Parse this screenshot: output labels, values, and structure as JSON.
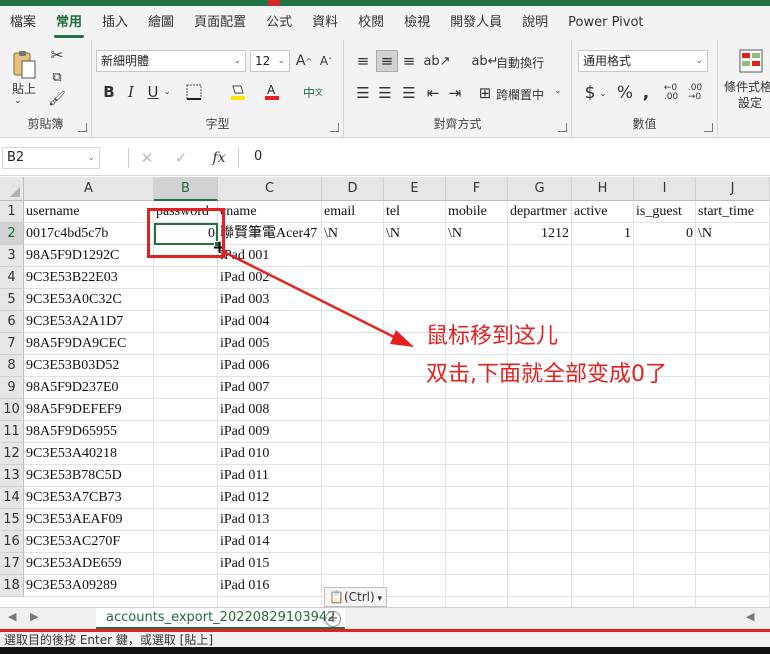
{
  "ribbon_tabs": [
    "檔案",
    "常用",
    "插入",
    "繪圖",
    "頁面配置",
    "公式",
    "資料",
    "校閱",
    "檢視",
    "開發人員",
    "說明",
    "Power Pivot"
  ],
  "active_tab": "常用",
  "clipboard": {
    "paste_label": "貼上",
    "group_label": "剪貼簿"
  },
  "font": {
    "name": "新細明體",
    "size": "12",
    "group_label": "字型",
    "bold": "B",
    "italic": "I",
    "underline": "U"
  },
  "alignment": {
    "wrap_text": "自動換行",
    "merge_center": "跨欄置中",
    "group_label": "對齊方式"
  },
  "number": {
    "format": "通用格式",
    "currency": "$",
    "percent": "%",
    "comma": ",",
    "group_label": "數值"
  },
  "styles": {
    "conditional_format": "條件式格",
    "format_label": "設定"
  },
  "formula_bar": {
    "name_box": "B2",
    "fx": "fx",
    "value": "0"
  },
  "columns": [
    "A",
    "B",
    "C",
    "D",
    "E",
    "F",
    "G",
    "H",
    "I",
    "J"
  ],
  "rows": [
    {
      "n": "1",
      "a": "username",
      "b": "password",
      "c": "cname",
      "d": "email",
      "e": "tel",
      "f": "mobile",
      "g": "departmer",
      "h": "active",
      "i": "is_guest",
      "j": "start_time"
    },
    {
      "n": "2",
      "a": "0017c4bd5c7b",
      "b": "0",
      "c": "聯賢筆電Acer47",
      "d": "\\N",
      "e": "\\N",
      "f": "\\N",
      "g": "1212",
      "h": "1",
      "i": "0",
      "j": "\\N"
    },
    {
      "n": "3",
      "a": "98A5F9D1292C",
      "c": "iPad 001"
    },
    {
      "n": "4",
      "a": "9C3E53B22E03",
      "c": "iPad 002"
    },
    {
      "n": "5",
      "a": "9C3E53A0C32C",
      "c": "iPad 003"
    },
    {
      "n": "6",
      "a": "9C3E53A2A1D7",
      "c": "iPad 004"
    },
    {
      "n": "7",
      "a": "98A5F9DA9CEC",
      "c": "iPad 005"
    },
    {
      "n": "8",
      "a": "9C3E53B03D52",
      "c": "iPad 006"
    },
    {
      "n": "9",
      "a": "98A5F9D237E0",
      "c": "iPad 007"
    },
    {
      "n": "10",
      "a": "98A5F9DEFEF9",
      "c": "iPad 008"
    },
    {
      "n": "11",
      "a": "98A5F9D65955",
      "c": "iPad 009"
    },
    {
      "n": "12",
      "a": "9C3E53A40218",
      "c": "iPad 010"
    },
    {
      "n": "13",
      "a": "9C3E53B78C5D",
      "c": "iPad 011"
    },
    {
      "n": "14",
      "a": "9C3E53A7CB73",
      "c": "iPad 012"
    },
    {
      "n": "15",
      "a": "9C3E53AEAF09",
      "c": "iPad 013"
    },
    {
      "n": "16",
      "a": "9C3E53AC270F",
      "c": "iPad 014"
    },
    {
      "n": "17",
      "a": "9C3E53ADE659",
      "c": "iPad 015"
    },
    {
      "n": "18",
      "a": "9C3E53A09289",
      "c": "iPad 016"
    }
  ],
  "annotation": {
    "line1": "鼠标移到这儿",
    "line2": "双击,下面就全部变成0了"
  },
  "paste_options": "(Ctrl)",
  "sheet_tab": "accounts_export_20220829103942",
  "status_text": "選取目的後按 Enter 鍵，或選取 [貼上]",
  "colors": {
    "accent": "#217346",
    "annotation": "#e52020"
  }
}
